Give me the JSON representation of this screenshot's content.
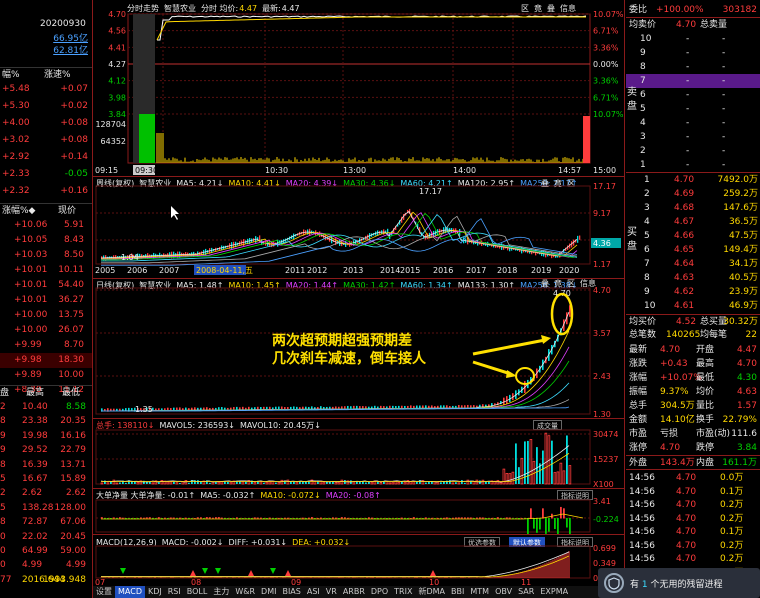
{
  "left": {
    "date": "20200930",
    "amt1": "66.95亿",
    "amt2": "62.81亿",
    "hdr1": {
      "c1": "幅%",
      "c2": "涨速%"
    },
    "rows1": [
      [
        "+5.48",
        "+0.07",
        "red",
        "red"
      ],
      [
        "+5.30",
        "+0.02",
        "red",
        "red"
      ],
      [
        "+4.00",
        "+0.08",
        "red",
        "red"
      ],
      [
        "+3.02",
        "+0.08",
        "red",
        "red"
      ],
      [
        "+2.92",
        "+0.14",
        "red",
        "red"
      ],
      [
        "+2.33",
        "-0.05",
        "red",
        "grn"
      ],
      [
        "+2.32",
        "+0.16",
        "red",
        "red"
      ]
    ],
    "hdr2": {
      "c1": "涨幅%◆",
      "c2": "现价"
    },
    "rows2": [
      [
        "+10.06",
        "5.91"
      ],
      [
        "+10.05",
        "8.43"
      ],
      [
        "+10.03",
        "8.50"
      ],
      [
        "+10.01",
        "10.11"
      ],
      [
        "+10.01",
        "54.40"
      ],
      [
        "+10.01",
        "36.27"
      ],
      [
        "+10.00",
        "13.75"
      ],
      [
        "+10.00",
        "26.07"
      ],
      [
        "+9.99",
        "8.70"
      ],
      [
        "+9.98",
        "18.30"
      ],
      [
        "+9.89",
        "10.00"
      ],
      [
        "+8.30",
        "11.12"
      ]
    ],
    "hdr3": {
      "c1": "盘",
      "c2": "最高",
      "c3": "最低"
    },
    "rows3": [
      [
        "2",
        "10.40",
        "8.58",
        "red",
        "red",
        "grn"
      ],
      [
        "8",
        "23.38",
        "20.35",
        "red",
        "red",
        "red"
      ],
      [
        "9",
        "19.98",
        "16.16",
        "red",
        "red",
        "red"
      ],
      [
        "9",
        "29.52",
        "22.79",
        "red",
        "red",
        "red"
      ],
      [
        "8",
        "16.39",
        "13.71",
        "red",
        "red",
        "red"
      ],
      [
        "5",
        "16.67",
        "15.89",
        "red",
        "red",
        "red"
      ],
      [
        "2",
        "2.62",
        "2.62",
        "red",
        "red",
        "red"
      ],
      [
        "5",
        "138.28",
        "128.00",
        "red",
        "red",
        "red"
      ],
      [
        "8",
        "72.87",
        "67.06",
        "red",
        "red",
        "red"
      ],
      [
        "0",
        "22.02",
        "20.45",
        "red",
        "red",
        "red"
      ],
      [
        "0",
        "64.99",
        "59.00",
        "red",
        "red",
        "red"
      ],
      [
        "0",
        "4.99",
        "4.99",
        "red",
        "red",
        "red"
      ],
      [
        "77",
        "2016.644",
        "1993.948",
        "red",
        "yel",
        "yel"
      ]
    ]
  },
  "minute": {
    "title": "分时走势",
    "name": "智慧农业",
    "label_ma": "分时 均价:",
    "avg": "4.47",
    "label_new": "最新:",
    "last": "4.47",
    "y_left": [
      "4.70",
      "4.56",
      "4.41",
      "4.27",
      "4.12",
      "3.98",
      "3.84"
    ],
    "y_right": [
      "10.07%",
      "6.71%",
      "3.36%",
      "0.00%",
      "3.36%",
      "6.71%",
      "10.07%"
    ],
    "vol_left": [
      "128704",
      "64352"
    ],
    "times": [
      "09:15",
      "09:30",
      "10:30",
      "13:00",
      "14:00",
      "14:57",
      "15:00"
    ],
    "icons": [
      "区",
      "竟",
      "叠",
      "信息"
    ]
  },
  "kyear": {
    "title": "周线(复权)",
    "name": "智慧农业",
    "ma": [
      [
        "MA5: 4.21↓",
        "wht"
      ],
      [
        "MA10: 4.41↓",
        "yel"
      ],
      [
        "MA20: 4.39↓",
        "mag"
      ],
      [
        "MA30: 4.36↓",
        "grn"
      ],
      [
        "MA60: 4.21↑",
        "cyan"
      ],
      [
        "MA120: 2.95↑",
        "wht"
      ],
      [
        "MA250: 2.17↑",
        "blu"
      ]
    ],
    "y_right": [
      "17.17",
      "9.17",
      "4.36",
      "1.17"
    ],
    "peak": "17.17",
    "low": "1.04",
    "years": [
      "2005",
      "2006",
      "2007",
      "2008-04-11,五",
      "2011",
      "2012",
      "2013",
      "2014",
      "2015",
      "2016",
      "2017",
      "2018",
      "2019",
      "2020"
    ],
    "icons": [
      "叠",
      "竟",
      "区"
    ]
  },
  "kday": {
    "title": "日线(复权)",
    "name": "智慧农业",
    "ma": [
      [
        "MA5: 1.48↑",
        "wht"
      ],
      [
        "MA10: 1.45↑",
        "yel"
      ],
      [
        "MA20: 1.44↑",
        "mag"
      ],
      [
        "MA30: 1.42↑",
        "grn"
      ],
      [
        "MA60: 1.34↑",
        "cyan"
      ],
      [
        "MA133: 1.30↑",
        "wht"
      ],
      [
        "MA256: 1.38↓",
        "blu"
      ]
    ],
    "y_right": [
      "4.70",
      "3.57",
      "2.43",
      "1.30"
    ],
    "peak": "4.70",
    "low": "1.35",
    "icons": [
      "叠",
      "竟",
      "区",
      "信息"
    ]
  },
  "callout": {
    "line1": "两次超预期超强预期差",
    "line2": "几次刹车减速，倒车接人"
  },
  "volume": {
    "label": "总手: 138110↓",
    "mavol5": "MAVOL5: 236593↓",
    "mavol10": "MAVOL10: 20.45万↓",
    "btn": "成交量",
    "y_right": [
      "30474",
      "15237",
      "X100"
    ]
  },
  "net": {
    "label": "大单净量 大单净量: -0.01↑",
    "ma5": "MA5: -0.032↑",
    "ma10": "MA10: -0.072↓",
    "ma20": "MA20: -0.08↑",
    "btn": "指标说明",
    "y_right": [
      "3.41",
      "-0.224"
    ]
  },
  "macd": {
    "label": "MACD(12,26,9)",
    "macd": "MACD: -0.002↓",
    "diff": "DIFF: +0.031↓",
    "dea": "DEA: +0.032↓",
    "btns": [
      "优选参数",
      "默认参数",
      "指标说明"
    ],
    "y_right": [
      "0.699",
      "0.349",
      "0.000"
    ],
    "months": [
      "07",
      "08",
      "09",
      "10",
      "11"
    ]
  },
  "tabs": [
    [
      "设置",
      false
    ],
    [
      "MACD",
      true
    ],
    [
      "KDJ",
      false
    ],
    [
      "RSI",
      false
    ],
    [
      "BOLL",
      false
    ],
    [
      "主力",
      false
    ],
    [
      "W&R",
      false
    ],
    [
      "DMI",
      false
    ],
    [
      "BIAS",
      false
    ],
    [
      "ASI",
      false
    ],
    [
      "VR",
      false
    ],
    [
      "ARBR",
      false
    ],
    [
      "DPO",
      false
    ],
    [
      "TRIX",
      false
    ],
    [
      "新DMA",
      false
    ],
    [
      "BBI",
      false
    ],
    [
      "MTM",
      false
    ],
    [
      "OBV",
      false
    ],
    [
      "SAR",
      false
    ],
    [
      "EXPMA",
      false
    ]
  ],
  "right": {
    "wb_label": "委比",
    "wb_val": "+100.00%",
    "wc_val": "303182",
    "sell_label": "均卖价",
    "sell_price": "4.70",
    "sell_total_label": "总卖量",
    "ask": [
      "10",
      "9",
      "8",
      "7",
      "6",
      "5",
      "4",
      "3",
      "2",
      "1"
    ],
    "side_sell": "卖盘",
    "bids": [
      [
        "1",
        "4.70",
        "7492.0万"
      ],
      [
        "2",
        "4.69",
        "259.2万"
      ],
      [
        "3",
        "4.68",
        "147.6万"
      ],
      [
        "4",
        "4.67",
        "36.5万"
      ],
      [
        "5",
        "4.66",
        "47.5万"
      ],
      [
        "6",
        "4.65",
        "149.4万"
      ],
      [
        "7",
        "4.64",
        "34.1万"
      ],
      [
        "8",
        "4.63",
        "40.5万"
      ],
      [
        "9",
        "4.62",
        "23.9万"
      ],
      [
        "10",
        "4.61",
        "46.9万"
      ]
    ],
    "side_buy": "买盘",
    "buy_label": "均买价",
    "buy_price": "4.52",
    "buy_total_label": "总买量",
    "buy_total": "30.32万",
    "cnt_label": "总笔数",
    "cnt": "140265",
    "wl_label": "均每笔",
    "wl": "22",
    "quote": [
      [
        "最新",
        "4.70",
        "red",
        "开盘",
        "4.47",
        "red"
      ],
      [
        "涨跌",
        "+0.43",
        "red",
        "最高",
        "4.70",
        "red"
      ],
      [
        "涨幅",
        "+10.07%",
        "red",
        "最低",
        "4.30",
        "grn"
      ],
      [
        "振幅",
        "9.37%",
        "yel",
        "均价",
        "4.63",
        "red"
      ],
      [
        "总手",
        "304.5万",
        "yel",
        "量比",
        "1.57",
        "red"
      ],
      [
        "金额",
        "14.10亿",
        "yel",
        "换手",
        "22.79%",
        "yel"
      ],
      [
        "市盈",
        "亏损",
        "wht",
        "市盈(动)",
        "111.6",
        "wht"
      ],
      [
        "涨停",
        "4.70",
        "red",
        "跌停",
        "3.84",
        "grn"
      ],
      [
        "外盘",
        "143.4万",
        "red",
        "内盘",
        "161.1万",
        "grn"
      ]
    ],
    "ticks": [
      [
        "14:56",
        "4.70",
        "0.0万"
      ],
      [
        "14:56",
        "4.70",
        "0.1万"
      ],
      [
        "14:56",
        "4.70",
        "0.2万"
      ],
      [
        "14:56",
        "4.70",
        "0.2万"
      ],
      [
        "14:56",
        "4.70",
        "0.1万"
      ],
      [
        "14:56",
        "4.70",
        "0.2万"
      ],
      [
        "14:56",
        "4.70",
        "0.2万"
      ],
      [
        "14:56",
        "4.70",
        "0.3万"
      ]
    ]
  },
  "toast": {
    "pre": "有",
    "count": "1",
    "post": "个无用的残留进程"
  }
}
